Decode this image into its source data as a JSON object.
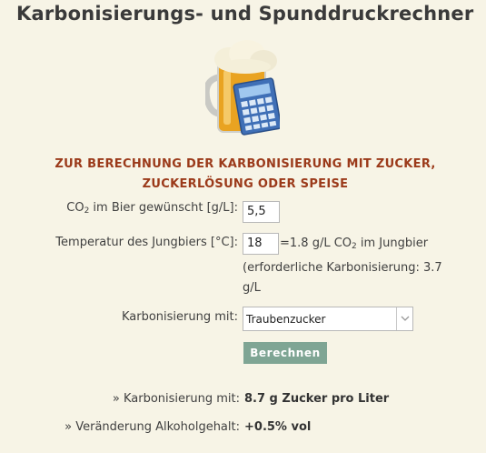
{
  "title": "Karbonisierungs- und Spunddruckrechner",
  "logo": {
    "icon": "beer-mug-calculator-icon"
  },
  "heading": {
    "line1": "ZUR BERECHNUNG DER KARBONISIERUNG MIT ZUCKER,",
    "line2": "ZUCKERLÖSUNG ODER SPEISE"
  },
  "co2": {
    "label_pre": "CO",
    "label_sub": "2",
    "label_post": " im Bier gewünscht [g/L]:",
    "value": "5,5"
  },
  "temperature": {
    "label": "Temperatur des Jungbiers [°C]:",
    "value": "18",
    "info_pre": "=1.8 g/L CO",
    "info_sub": "2",
    "info_post": " im Jungbier",
    "note_line1": "(erforderliche Karbonisierung: 3.7",
    "note_line2": "g/L"
  },
  "carbonation_method": {
    "label": "Karbonisierung mit:",
    "selected": "Traubenzucker"
  },
  "calculate_button": "Berechnen",
  "results": {
    "carbonation": {
      "label": "» Karbonisierung mit:",
      "value": "8.7 g Zucker pro Liter"
    },
    "alcohol_change": {
      "label": "» Veränderung Alkoholgehalt:",
      "value": "+0.5% vol"
    }
  }
}
